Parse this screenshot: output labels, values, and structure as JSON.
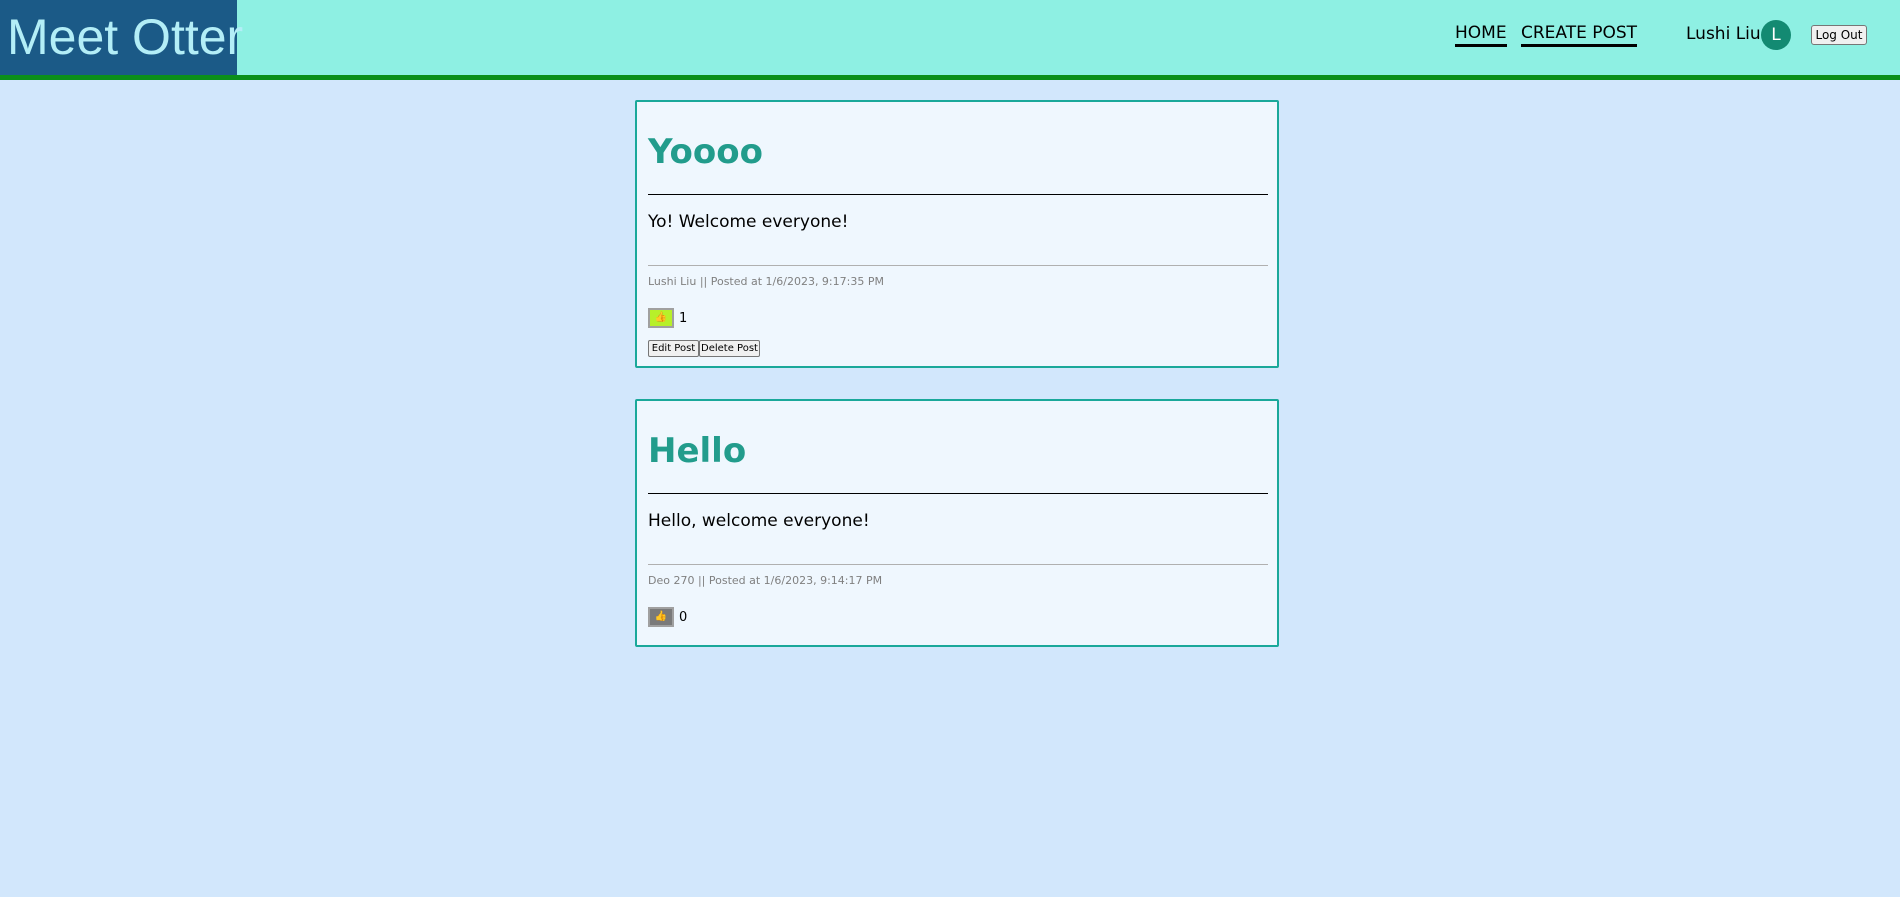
{
  "header": {
    "logo_text": "Meet Otter",
    "nav": {
      "home": "HOME",
      "create_post": "CREATE POST"
    },
    "user": {
      "name": "Lushi Liu",
      "avatar_initial": "L"
    },
    "logout_label": "Log Out"
  },
  "posts": [
    {
      "title": "Yoooo",
      "body": "Yo! Welcome everyone!",
      "meta": "Lushi Liu ||   Posted at 1/6/2023, 9:17:35 PM",
      "like_icon": "thumbs-up-icon",
      "like_state": "liked",
      "like_color": "#b7f02a",
      "like_count": "1",
      "edit_label": "Edit Post",
      "delete_label": "Delete Post"
    },
    {
      "title": "Hello",
      "body": "Hello, welcome everyone!",
      "meta": "Deo 270 ||   Posted at 1/6/2023, 9:14:17 PM",
      "like_icon": "thumbs-up-icon",
      "like_state": "not-liked",
      "like_color": "#7a7a7a",
      "like_count": "0"
    }
  ],
  "colors": {
    "page_background": "#d2e7fc",
    "header_background": "#8ef0e3",
    "header_border": "#0b8f1a",
    "logo_background": "#1b5a87",
    "post_title": "#229c8c",
    "post_border": "#1aa89a"
  }
}
